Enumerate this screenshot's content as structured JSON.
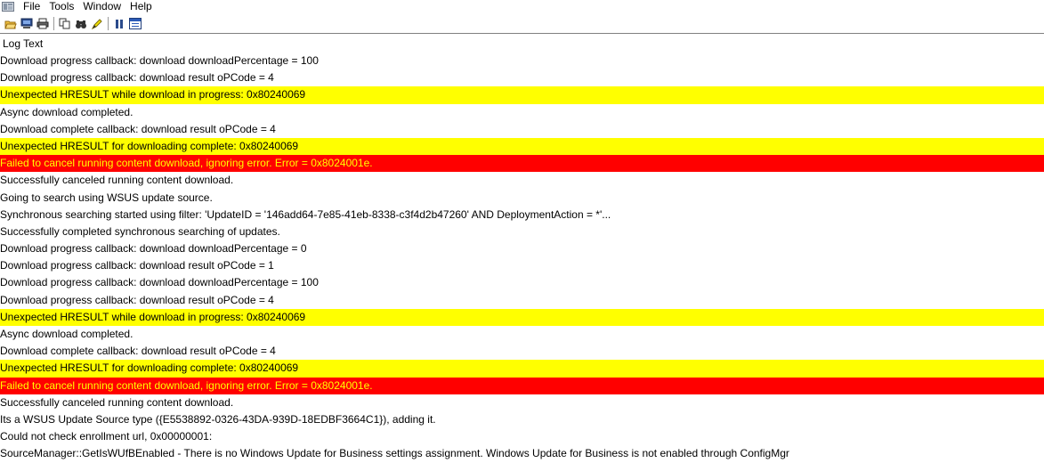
{
  "menu": {
    "items": [
      "File",
      "Tools",
      "Window",
      "Help"
    ]
  },
  "toolbar": {
    "buttons": [
      "open-icon",
      "computer-icon",
      "print-icon",
      "copy-icon",
      "find-icon",
      "highlight-icon",
      "pause-icon",
      "window-icon"
    ]
  },
  "log": {
    "column_header": "Log Text",
    "rows": [
      {
        "text": "Download progress callback: download downloadPercentage = 100",
        "level": "normal"
      },
      {
        "text": "Download progress callback: download result oPCode = 4",
        "level": "normal"
      },
      {
        "text": "Unexpected HRESULT while download in progress: 0x80240069",
        "level": "warn"
      },
      {
        "text": "Async download completed.",
        "level": "normal"
      },
      {
        "text": "Download complete callback: download result oPCode = 4",
        "level": "normal"
      },
      {
        "text": "Unexpected HRESULT for downloading complete: 0x80240069",
        "level": "warn"
      },
      {
        "text": "Failed to cancel running content download, ignoring error. Error = 0x8024001e.",
        "level": "err"
      },
      {
        "text": "Successfully canceled running content download.",
        "level": "normal"
      },
      {
        "text": "Going to search using WSUS update source.",
        "level": "normal"
      },
      {
        "text": "Synchronous searching started using filter: 'UpdateID = '146add64-7e85-41eb-8338-c3f4d2b47260' AND DeploymentAction = *'...",
        "level": "normal"
      },
      {
        "text": "Successfully completed synchronous searching of updates.",
        "level": "normal"
      },
      {
        "text": "Download progress callback: download downloadPercentage = 0",
        "level": "normal"
      },
      {
        "text": "Download progress callback: download result oPCode = 1",
        "level": "normal"
      },
      {
        "text": "Download progress callback: download downloadPercentage = 100",
        "level": "normal"
      },
      {
        "text": "Download progress callback: download result oPCode = 4",
        "level": "normal"
      },
      {
        "text": "Unexpected HRESULT while download in progress: 0x80240069",
        "level": "warn"
      },
      {
        "text": "Async download completed.",
        "level": "normal"
      },
      {
        "text": "Download complete callback: download result oPCode = 4",
        "level": "normal"
      },
      {
        "text": "Unexpected HRESULT for downloading complete: 0x80240069",
        "level": "warn"
      },
      {
        "text": "Failed to cancel running content download, ignoring error. Error = 0x8024001e.",
        "level": "err"
      },
      {
        "text": "Successfully canceled running content download.",
        "level": "normal"
      },
      {
        "text": "Its a WSUS Update Source type ({E5538892-0326-43DA-939D-18EDBF3664C1}), adding it.",
        "level": "normal"
      },
      {
        "text": "Could not check enrollment url, 0x00000001:",
        "level": "normal"
      },
      {
        "text": "SourceManager::GetIsWUfBEnabled - There is no Windows Update for Business settings assignment. Windows Update for Business is not enabled through ConfigMgr",
        "level": "normal"
      }
    ]
  },
  "colors": {
    "warn_bg": "#ffff00",
    "err_bg": "#ff0000",
    "err_text": "#ffff00"
  }
}
